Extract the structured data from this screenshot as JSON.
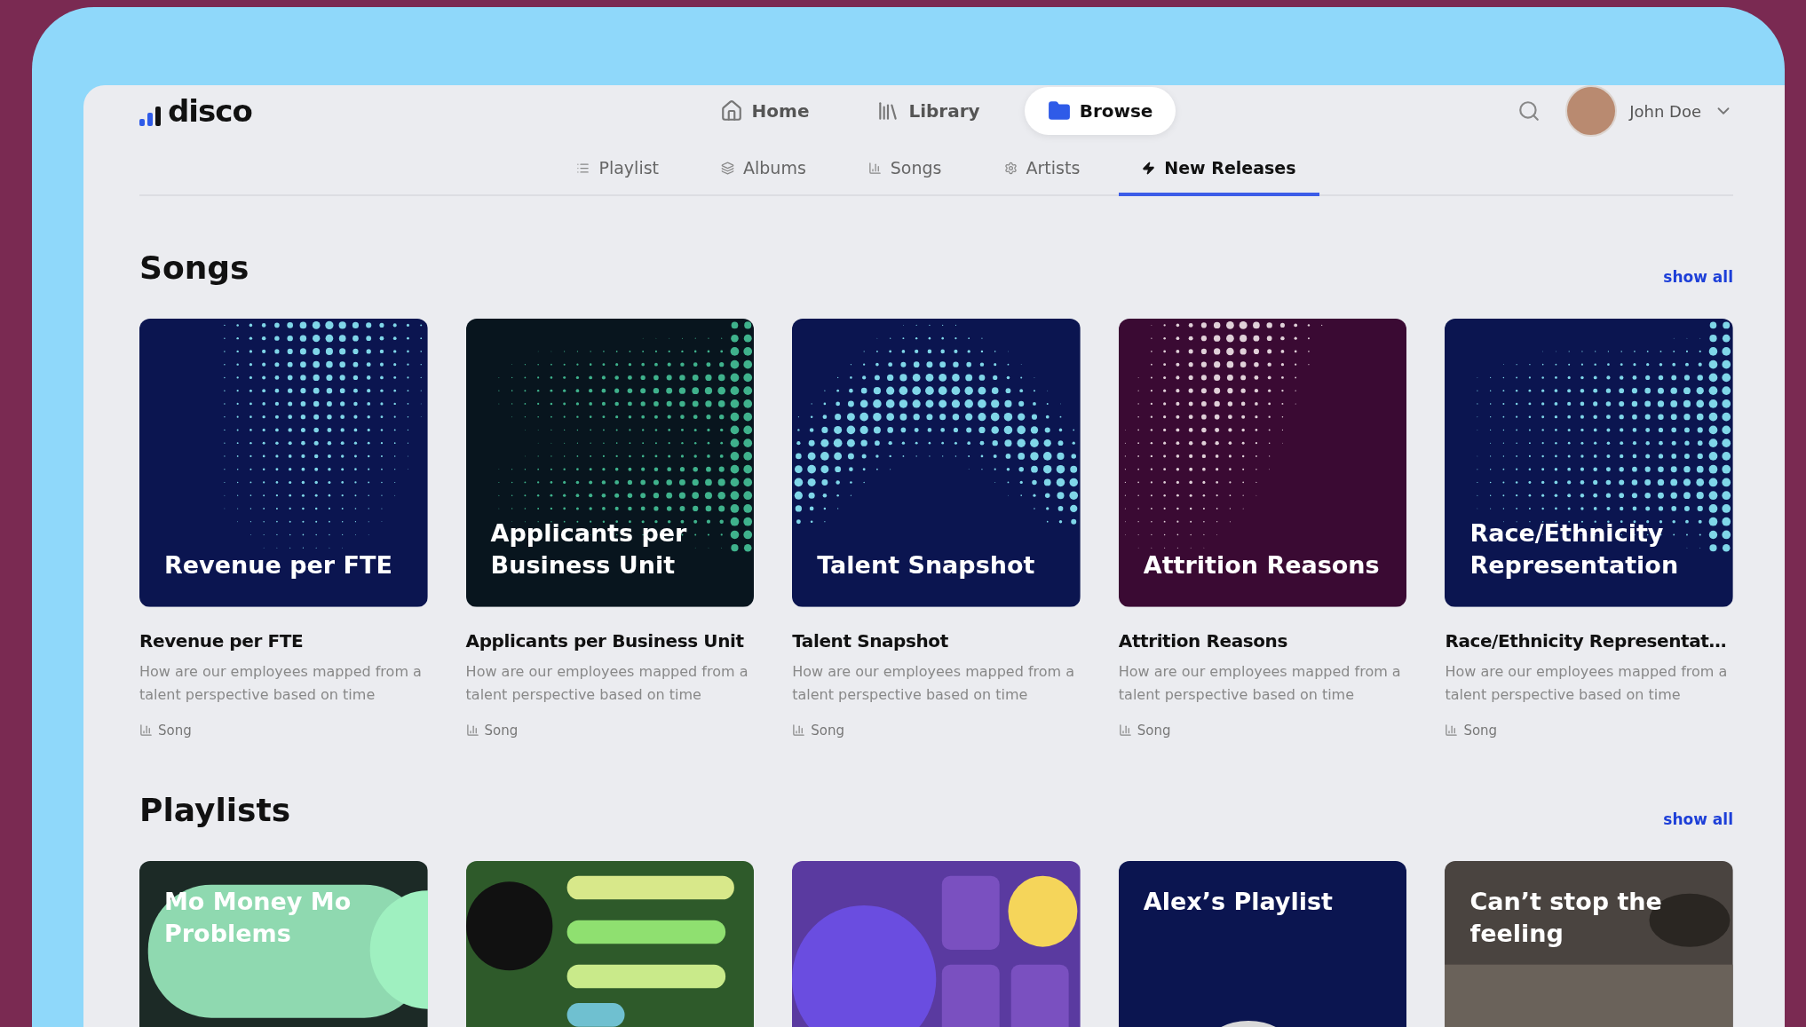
{
  "logo": {
    "text": "disco"
  },
  "nav": [
    {
      "label": "Home",
      "selected": false
    },
    {
      "label": "Library",
      "selected": false
    },
    {
      "label": "Browse",
      "selected": true
    }
  ],
  "user": {
    "name": "John Doe"
  },
  "tabs": [
    {
      "label": "Playlist",
      "selected": false
    },
    {
      "label": "Albums",
      "selected": false
    },
    {
      "label": "Songs",
      "selected": false
    },
    {
      "label": "Artists",
      "selected": false
    },
    {
      "label": "New Releases",
      "selected": true
    }
  ],
  "songs": {
    "title": "Songs",
    "show_all": "show all",
    "items": [
      {
        "cover_text": "Revenue per FTE",
        "title": "Revenue per FTE",
        "description": "How are our employees mapped from a talent perspective based on time",
        "type": "Song"
      },
      {
        "cover_text": "Applicants per Business Unit",
        "title": "Applicants per Business Unit",
        "description": "How are our employees mapped from a talent perspective based on time",
        "type": "Song"
      },
      {
        "cover_text": "Talent Snapshot",
        "title": "Talent Snapshot",
        "description": "How are our employees mapped from a talent perspective based on time",
        "type": "Song"
      },
      {
        "cover_text": "Attrition Reasons",
        "title": "Attrition Reasons",
        "description": "How are our employees mapped from a talent perspective based on time",
        "type": "Song"
      },
      {
        "cover_text": "Race/Ethnicity Representation",
        "title": "Race/Ethnicity Representat…",
        "description": "How are our employees mapped from a talent perspective based on time",
        "type": "Song"
      }
    ]
  },
  "playlists": {
    "title": "Playlists",
    "show_all": "show all",
    "items": [
      {
        "kind": "titled",
        "cover_text": "Mo Money Mo Problems"
      },
      {
        "kind": "picture"
      },
      {
        "kind": "picture"
      },
      {
        "kind": "titled",
        "cover_text": "Alex’s Playlist"
      },
      {
        "kind": "titled",
        "cover_text": "Can’t stop the feeling"
      }
    ]
  }
}
